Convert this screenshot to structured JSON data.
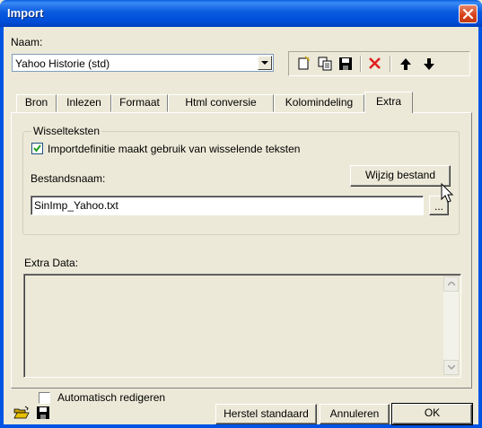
{
  "window": {
    "title": "Import",
    "close_label": "Close"
  },
  "naam": {
    "label": "Naam:",
    "value": "Yahoo Historie (std)"
  },
  "toolbar": {
    "icons": [
      "new-document-icon",
      "copy-icon",
      "save-icon",
      "delete-icon",
      "move-up-icon",
      "move-down-icon"
    ]
  },
  "tabs": [
    "Bron",
    "Inlezen",
    "Formaat",
    "Html conversie",
    "Kolomindeling",
    "Extra"
  ],
  "active_tab": "Extra",
  "wisselteksten": {
    "group_title": "Wisselteksten",
    "checkbox_label": "Importdefinitie maakt gebruik van wisselende teksten",
    "checked": true,
    "bestandsnaam_label": "Bestandsnaam:",
    "wijzig_button": "Wijzig bestand",
    "filename_value": "SinImp_Yahoo.txt",
    "browse_label": "..."
  },
  "extra_data": {
    "label": "Extra Data:",
    "value": ""
  },
  "auto_redigeren": {
    "label": "Automatisch redigeren",
    "checked": false
  },
  "footer": {
    "herstel": "Herstel standaard",
    "annuleren": "Annuleren",
    "ok": "OK"
  },
  "colors": {
    "title_bar": "#0054e3",
    "face": "#ece9d8",
    "close": "#d9431b"
  }
}
